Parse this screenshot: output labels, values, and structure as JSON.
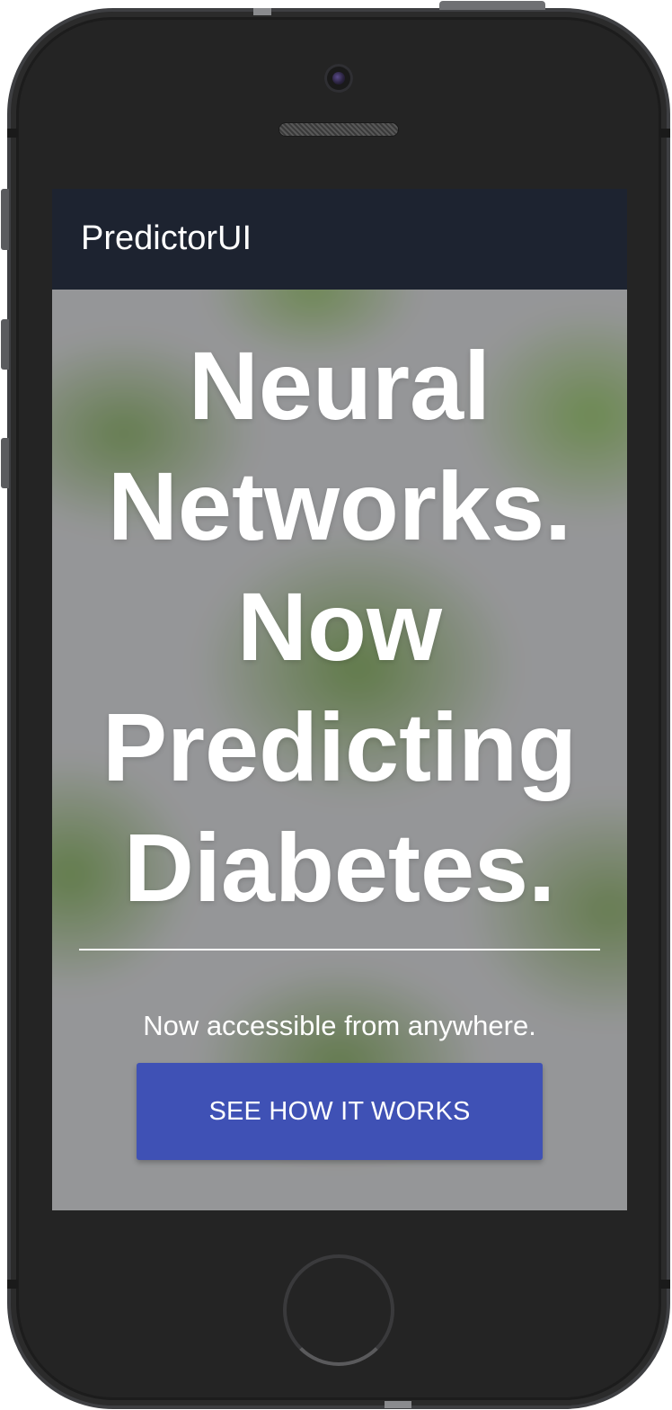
{
  "app": {
    "brand": "PredictorUI"
  },
  "hero": {
    "headline": [
      "Neural",
      "Networks.",
      "Now",
      "Predicting",
      "Diabetes."
    ],
    "tagline": "Now accessible from anywhere.",
    "cta_label": "SEE HOW IT WORKS"
  },
  "colors": {
    "navbar": "#1d2330",
    "cta": "#3f51b5",
    "text": "#ffffff",
    "device_body": "#242424"
  },
  "device": {
    "model": "phone-mockup",
    "icons": [
      "front-camera-icon",
      "earpiece-speaker-icon",
      "home-button"
    ]
  }
}
